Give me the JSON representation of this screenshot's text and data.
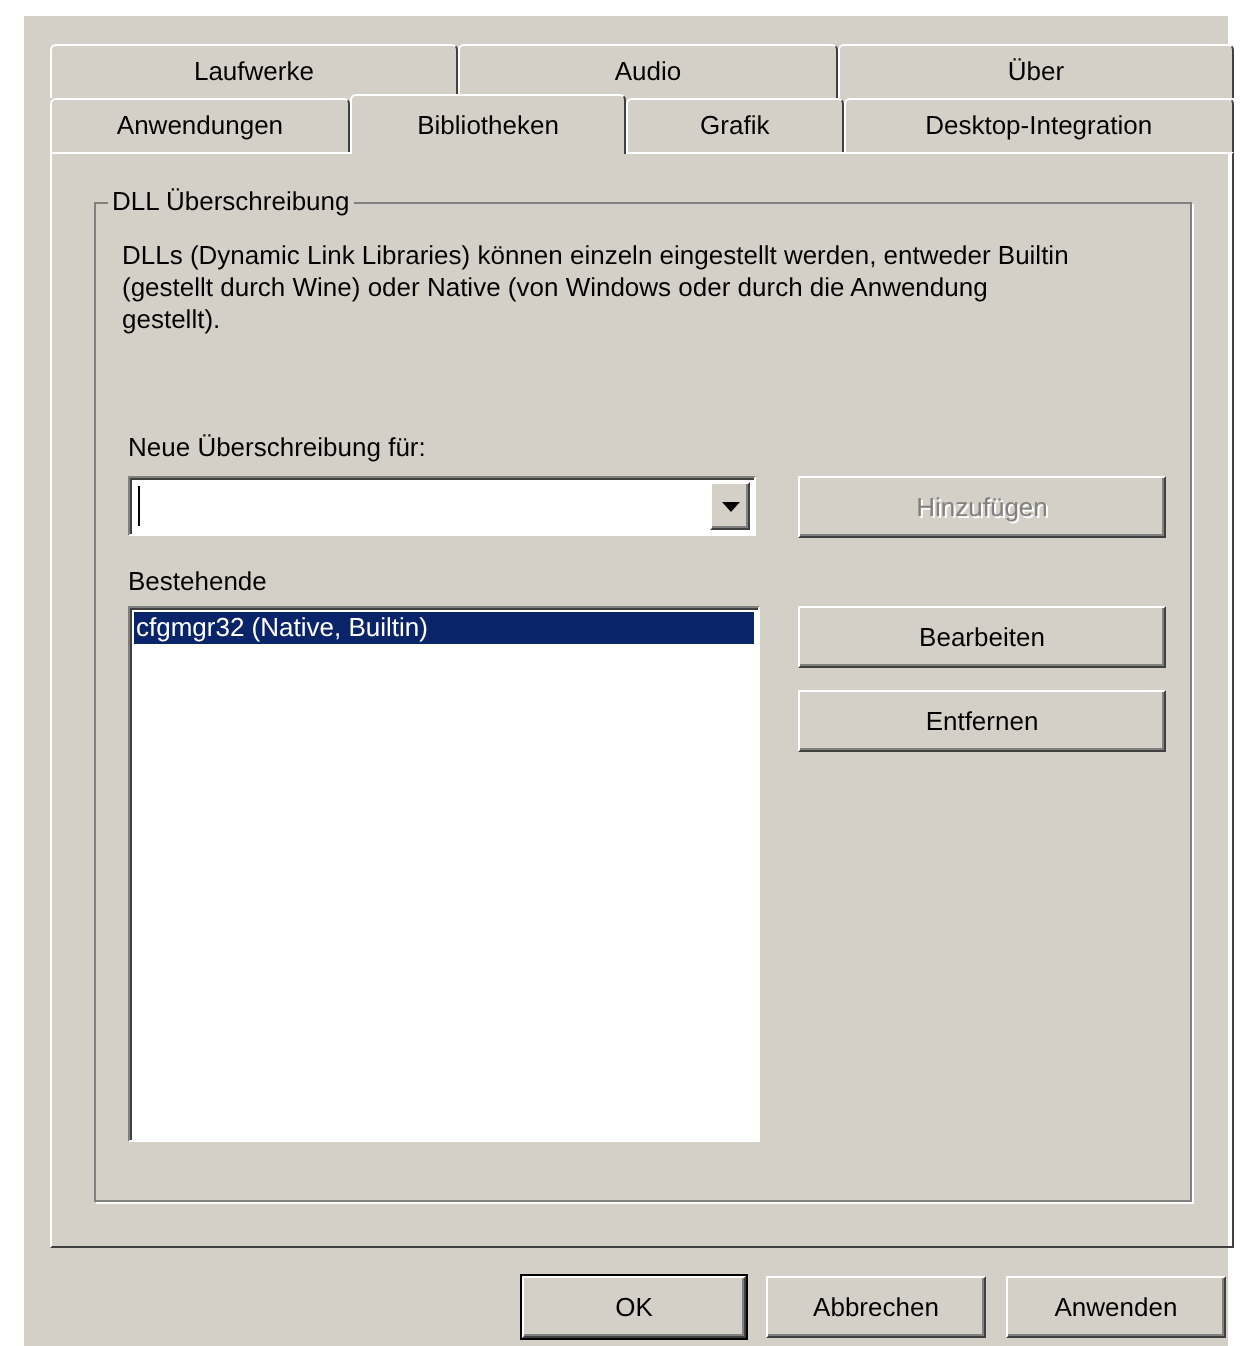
{
  "tab_rows": [
    {
      "tabs": [
        {
          "label": "Laufwerke",
          "selected": false
        },
        {
          "label": "Audio",
          "selected": false
        },
        {
          "label": "Über",
          "selected": false
        }
      ]
    },
    {
      "tabs": [
        {
          "label": "Anwendungen",
          "selected": false
        },
        {
          "label": "Bibliotheken",
          "selected": true
        },
        {
          "label": "Grafik",
          "selected": false
        },
        {
          "label": "Desktop-Integration",
          "selected": false
        }
      ]
    }
  ],
  "group": {
    "title": "DLL Überschreibung",
    "description": "DLLs (Dynamic Link Libraries) können einzeln eingestellt werden, entweder Builtin (gestellt durch Wine) oder Native (von Windows oder durch die Anwendung gestellt).",
    "new_override": {
      "label": "Neue Überschreibung für:"
    },
    "add_button": {
      "label": "Hinzufügen",
      "disabled": true
    },
    "existing": {
      "label": "Bestehende",
      "items": [
        {
          "label": "cfgmgr32 (Native, Builtin)",
          "selected": true
        }
      ]
    },
    "side_buttons": [
      {
        "label": "Bearbeiten",
        "disabled": false
      },
      {
        "label": "Entfernen",
        "disabled": false
      }
    ]
  },
  "footer_buttons": [
    {
      "label": "OK",
      "default": true
    },
    {
      "label": "Abbrechen",
      "default": false
    },
    {
      "label": "Anwenden",
      "default": false
    }
  ]
}
